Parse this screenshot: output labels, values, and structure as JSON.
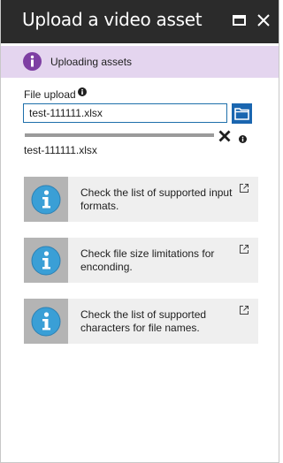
{
  "blade": {
    "title": "Upload a video asset",
    "maximize_icon": "maximize-icon",
    "close_icon": "close-icon"
  },
  "notice": {
    "text": "Uploading assets",
    "icon": "info-icon",
    "color": "#7e3fa3",
    "background": "#e4d5ef"
  },
  "upload": {
    "label": "File upload",
    "file_value": "test-111111.xlsx",
    "file_name": "test-111111.xlsx",
    "progress": 1.0
  },
  "cards": [
    {
      "text": "Check the list of supported input formats.",
      "icon": "info-icon",
      "link_icon": "external-link-icon"
    },
    {
      "text": "Check file size limitations for enconding.",
      "icon": "info-icon",
      "link_icon": "external-link-icon"
    },
    {
      "text": "Check the list of supported characters for file names.",
      "icon": "info-icon",
      "link_icon": "external-link-icon"
    }
  ],
  "colors": {
    "titlebar": "#2b2b2b",
    "accent": "#1a66b0",
    "card_bg": "#efefef",
    "info_blue": "#3a9fd6"
  }
}
